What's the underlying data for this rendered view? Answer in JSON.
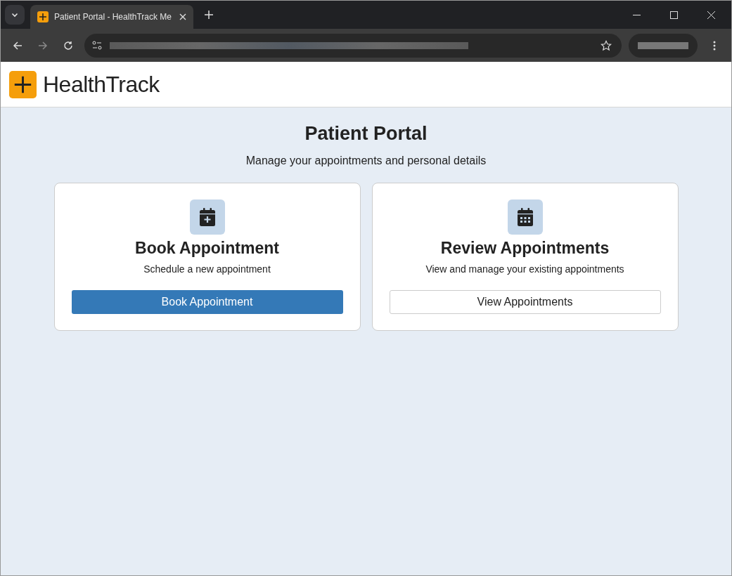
{
  "browser": {
    "tab_title": "Patient Portal - HealthTrack Me",
    "tab_selected": true
  },
  "header": {
    "brand": "HealthTrack"
  },
  "page": {
    "title": "Patient Portal",
    "subtitle": "Manage your appointments and personal details"
  },
  "cards": [
    {
      "kind": "book",
      "title": "Book Appointment",
      "description": "Schedule a new appointment",
      "button": {
        "label": "Book Appointment"
      }
    },
    {
      "kind": "review",
      "title": "Review Appointments",
      "description": "View and manage your existing appointments",
      "button": {
        "label": "View Appointments"
      }
    }
  ]
}
